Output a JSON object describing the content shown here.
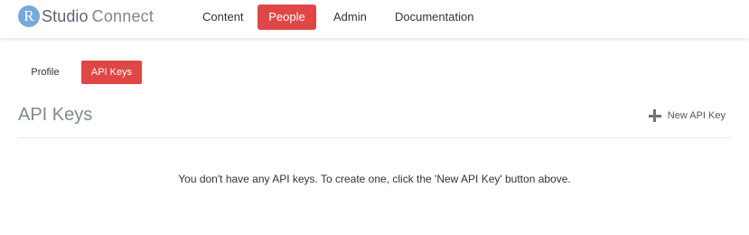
{
  "header": {
    "brand": {
      "logo_letter": "R",
      "word1": "Studio",
      "word2": "Connect",
      "logo_color": "#75aadb"
    },
    "nav": {
      "items": [
        {
          "label": "Content",
          "active": false
        },
        {
          "label": "People",
          "active": true
        },
        {
          "label": "Admin",
          "active": false
        },
        {
          "label": "Documentation",
          "active": false
        }
      ]
    },
    "accent_color": "#e04646"
  },
  "subtabs": {
    "items": [
      {
        "label": "Profile",
        "active": false
      },
      {
        "label": "API Keys",
        "active": true
      }
    ]
  },
  "main": {
    "title": "API Keys",
    "new_key_button": {
      "label": "New API Key",
      "icon": "plus-icon"
    },
    "empty_message": "You don't have any API keys. To create one, click the 'New API Key' button above."
  }
}
